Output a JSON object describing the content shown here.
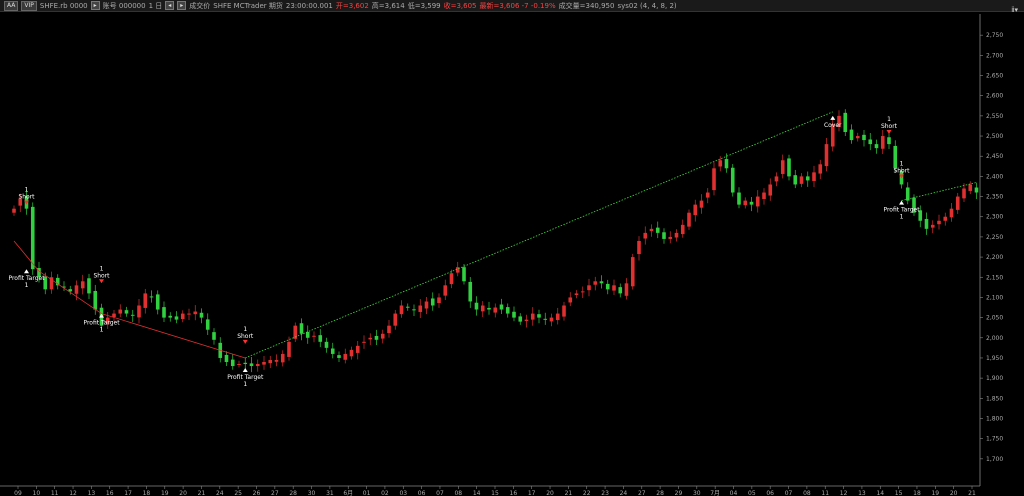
{
  "toolbar": {
    "size_button": "AA",
    "vip_button": "VIP",
    "symbol": "SHFE.rb 0000",
    "account": "账号 000000",
    "interval": "1 日",
    "mode": "成交价",
    "source": "SHFE MCTrader 期货",
    "time": "23:00:00.001",
    "open": "开=3,602",
    "high": "高=3,614",
    "low": "低=3,599",
    "close": "收=3,605",
    "change": "最新=3,606 -7 -0.19%",
    "volume": "成交量=340,950",
    "strategy": "sys02 (4, 4, 8, 2)",
    "corner": "ⅱ▾"
  },
  "chart_data": {
    "type": "candlestick",
    "y_axis": {
      "side": "right",
      "ylim": [
        1650,
        2800
      ],
      "ticks": [
        "2,750",
        "2,700",
        "2,650",
        "2,600",
        "2,550",
        "2,500",
        "2,450",
        "2,400",
        "2,350",
        "2,300",
        "2,250",
        "2,200",
        "2,150",
        "2,100",
        "2,050",
        "2,000",
        "1,950",
        "1,900",
        "1,850",
        "1,800",
        "1,750",
        "1,700"
      ]
    },
    "x_axis": {
      "ticks": [
        "09",
        "10",
        "11",
        "12",
        "13",
        "16",
        "17",
        "18",
        "19",
        "20",
        "21",
        "24",
        "25",
        "26",
        "27",
        "28",
        "30",
        "31",
        "6月",
        "01",
        "02",
        "03",
        "06",
        "07",
        "08",
        "14",
        "15",
        "16",
        "17",
        "20",
        "21",
        "22",
        "23",
        "24",
        "27",
        "28",
        "29",
        "30",
        "7月",
        "04",
        "05",
        "06",
        "07",
        "08",
        "11",
        "12",
        "13",
        "14",
        "15",
        "18",
        "19",
        "20",
        "21"
      ]
    },
    "grid": false,
    "colors": {
      "up": "#e03030",
      "down": "#30d040",
      "wick": "#c0c0c0",
      "trend_up": "#40e040",
      "trend_down": "#e03030"
    },
    "close_path": [
      [
        0,
        2320
      ],
      [
        1,
        2345
      ],
      [
        2,
        2320
      ],
      [
        3,
        2170
      ],
      [
        4,
        2150
      ],
      [
        5,
        2120
      ],
      [
        6,
        2150
      ],
      [
        7,
        2130
      ],
      [
        8,
        2125
      ],
      [
        9,
        2115
      ],
      [
        10,
        2130
      ],
      [
        11,
        2140
      ],
      [
        12,
        2110
      ],
      [
        13,
        2070
      ],
      [
        14,
        2030
      ],
      [
        15,
        2050
      ],
      [
        16,
        2060
      ],
      [
        17,
        2070
      ],
      [
        18,
        2060
      ],
      [
        19,
        2055
      ],
      [
        20,
        2080
      ],
      [
        21,
        2110
      ],
      [
        22,
        2100
      ],
      [
        23,
        2070
      ],
      [
        24,
        2050
      ],
      [
        25,
        2050
      ],
      [
        26,
        2045
      ],
      [
        27,
        2060
      ],
      [
        28,
        2060
      ],
      [
        29,
        2065
      ],
      [
        30,
        2050
      ],
      [
        31,
        2020
      ],
      [
        32,
        1995
      ],
      [
        33,
        1950
      ],
      [
        34,
        1940
      ],
      [
        35,
        1930
      ],
      [
        36,
        1935
      ],
      [
        37,
        1935
      ],
      [
        38,
        1930
      ],
      [
        39,
        1935
      ],
      [
        40,
        1940
      ],
      [
        41,
        1945
      ],
      [
        42,
        1945
      ],
      [
        43,
        1960
      ],
      [
        44,
        1990
      ],
      [
        45,
        2030
      ],
      [
        46,
        2010
      ],
      [
        47,
        2000
      ],
      [
        48,
        2005
      ],
      [
        49,
        1990
      ],
      [
        50,
        1975
      ],
      [
        51,
        1960
      ],
      [
        52,
        1950
      ],
      [
        53,
        1960
      ],
      [
        54,
        1970
      ],
      [
        55,
        1980
      ],
      [
        56,
        1990
      ],
      [
        57,
        2000
      ],
      [
        58,
        1995
      ],
      [
        59,
        2010
      ],
      [
        60,
        2030
      ],
      [
        61,
        2060
      ],
      [
        62,
        2080
      ],
      [
        63,
        2075
      ],
      [
        64,
        2070
      ],
      [
        65,
        2080
      ],
      [
        66,
        2090
      ],
      [
        67,
        2080
      ],
      [
        68,
        2100
      ],
      [
        69,
        2130
      ],
      [
        70,
        2160
      ],
      [
        71,
        2175
      ],
      [
        72,
        2140
      ],
      [
        73,
        2090
      ],
      [
        74,
        2070
      ],
      [
        75,
        2080
      ],
      [
        76,
        2070
      ],
      [
        77,
        2075
      ],
      [
        78,
        2070
      ],
      [
        79,
        2060
      ],
      [
        80,
        2050
      ],
      [
        81,
        2040
      ],
      [
        82,
        2045
      ],
      [
        83,
        2060
      ],
      [
        84,
        2050
      ],
      [
        85,
        2045
      ],
      [
        86,
        2050
      ],
      [
        87,
        2060
      ],
      [
        88,
        2080
      ],
      [
        89,
        2100
      ],
      [
        90,
        2110
      ],
      [
        91,
        2115
      ],
      [
        92,
        2130
      ],
      [
        93,
        2140
      ],
      [
        94,
        2135
      ],
      [
        95,
        2120
      ],
      [
        96,
        2130
      ],
      [
        97,
        2110
      ],
      [
        98,
        2135
      ],
      [
        99,
        2200
      ],
      [
        100,
        2240
      ],
      [
        101,
        2260
      ],
      [
        102,
        2270
      ],
      [
        103,
        2260
      ],
      [
        104,
        2245
      ],
      [
        105,
        2250
      ],
      [
        106,
        2260
      ],
      [
        107,
        2280
      ],
      [
        108,
        2310
      ],
      [
        109,
        2330
      ],
      [
        110,
        2340
      ],
      [
        111,
        2360
      ],
      [
        112,
        2420
      ],
      [
        113,
        2440
      ],
      [
        114,
        2420
      ],
      [
        115,
        2360
      ],
      [
        116,
        2330
      ],
      [
        117,
        2340
      ],
      [
        118,
        2330
      ],
      [
        119,
        2350
      ],
      [
        120,
        2360
      ],
      [
        121,
        2380
      ],
      [
        122,
        2400
      ],
      [
        123,
        2440
      ],
      [
        124,
        2400
      ],
      [
        125,
        2380
      ],
      [
        126,
        2400
      ],
      [
        127,
        2390
      ],
      [
        128,
        2410
      ],
      [
        129,
        2430
      ],
      [
        130,
        2480
      ],
      [
        131,
        2530
      ],
      [
        132,
        2550
      ],
      [
        133,
        2510
      ],
      [
        134,
        2490
      ],
      [
        135,
        2500
      ],
      [
        136,
        2490
      ],
      [
        137,
        2480
      ],
      [
        138,
        2470
      ],
      [
        139,
        2500
      ],
      [
        140,
        2480
      ],
      [
        141,
        2420
      ],
      [
        142,
        2380
      ],
      [
        143,
        2340
      ],
      [
        144,
        2310
      ],
      [
        145,
        2290
      ],
      [
        146,
        2270
      ],
      [
        147,
        2280
      ],
      [
        148,
        2290
      ],
      [
        149,
        2300
      ],
      [
        150,
        2320
      ],
      [
        151,
        2350
      ],
      [
        152,
        2370
      ],
      [
        153,
        2380
      ],
      [
        154,
        2360
      ]
    ],
    "trendlines": [
      {
        "color": "green",
        "from": [
          37,
          1950
        ],
        "to": [
          131,
          2560
        ]
      },
      {
        "color": "green",
        "from": [
          142,
          2340
        ],
        "to": [
          154,
          2385
        ]
      },
      {
        "color": "red",
        "from": [
          0,
          2240
        ],
        "to": [
          4,
          2165
        ]
      },
      {
        "color": "red",
        "from": [
          4,
          2165
        ],
        "to": [
          14,
          2060
        ]
      },
      {
        "color": "red",
        "from": [
          14,
          2060
        ],
        "to": [
          37,
          1950
        ]
      }
    ],
    "signals": [
      {
        "label": "Short",
        "qty": "1",
        "index": 2,
        "price": 2335,
        "kind": "short"
      },
      {
        "label": "Profit Target",
        "qty": "1",
        "index": 2,
        "price": 2165,
        "kind": "cover"
      },
      {
        "label": "Short",
        "qty": "1",
        "index": 14,
        "price": 2140,
        "kind": "short"
      },
      {
        "label": "Profit Target",
        "qty": "1",
        "index": 14,
        "price": 2055,
        "kind": "cover"
      },
      {
        "label": "Short",
        "qty": "1",
        "index": 37,
        "price": 1990,
        "kind": "short"
      },
      {
        "label": "Profit Target",
        "qty": "1",
        "index": 37,
        "price": 1920,
        "kind": "cover"
      },
      {
        "label": "Cover",
        "qty": "",
        "index": 131,
        "price": 2545,
        "kind": "cover"
      },
      {
        "label": "Short",
        "qty": "1",
        "index": 140,
        "price": 2510,
        "kind": "short"
      },
      {
        "label": "Short",
        "qty": "1",
        "index": 142,
        "price": 2400,
        "kind": "short"
      },
      {
        "label": "Profit Target",
        "qty": "1",
        "index": 142,
        "price": 2335,
        "kind": "cover"
      }
    ]
  }
}
